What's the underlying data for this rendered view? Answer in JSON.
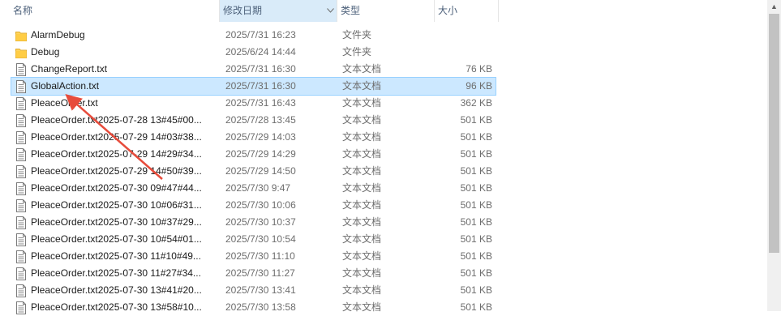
{
  "columns": {
    "name": "名称",
    "date": "修改日期",
    "type": "类型",
    "size": "大小"
  },
  "sort_indicator": "^",
  "dropdown_glyph": "v",
  "scroll_up_glyph": "▲",
  "files": [
    {
      "name": "AlarmDebug",
      "date": "2025/7/31 16:23",
      "type": "文件夹",
      "size": "",
      "icon": "folder-icon",
      "selected": false
    },
    {
      "name": "Debug",
      "date": "2025/6/24 14:44",
      "type": "文件夹",
      "size": "",
      "icon": "folder-icon",
      "selected": false
    },
    {
      "name": "ChangeReport.txt",
      "date": "2025/7/31 16:30",
      "type": "文本文档",
      "size": "76 KB",
      "icon": "text-file-icon",
      "selected": false
    },
    {
      "name": "GlobalAction.txt",
      "date": "2025/7/31 16:30",
      "type": "文本文档",
      "size": "96 KB",
      "icon": "text-file-icon",
      "selected": true
    },
    {
      "name": "PleaceOrder.txt",
      "date": "2025/7/31 16:43",
      "type": "文本文档",
      "size": "362 KB",
      "icon": "text-file-icon",
      "selected": false
    },
    {
      "name": "PleaceOrder.txt2025-07-28 13#45#00...",
      "date": "2025/7/28 13:45",
      "type": "文本文档",
      "size": "501 KB",
      "icon": "text-file-icon",
      "selected": false
    },
    {
      "name": "PleaceOrder.txt2025-07-29 14#03#38...",
      "date": "2025/7/29 14:03",
      "type": "文本文档",
      "size": "501 KB",
      "icon": "text-file-icon",
      "selected": false
    },
    {
      "name": "PleaceOrder.txt2025-07-29 14#29#34...",
      "date": "2025/7/29 14:29",
      "type": "文本文档",
      "size": "501 KB",
      "icon": "text-file-icon",
      "selected": false
    },
    {
      "name": "PleaceOrder.txt2025-07-29 14#50#39...",
      "date": "2025/7/29 14:50",
      "type": "文本文档",
      "size": "501 KB",
      "icon": "text-file-icon",
      "selected": false
    },
    {
      "name": "PleaceOrder.txt2025-07-30 09#47#44...",
      "date": "2025/7/30 9:47",
      "type": "文本文档",
      "size": "501 KB",
      "icon": "text-file-icon",
      "selected": false
    },
    {
      "name": "PleaceOrder.txt2025-07-30 10#06#31...",
      "date": "2025/7/30 10:06",
      "type": "文本文档",
      "size": "501 KB",
      "icon": "text-file-icon",
      "selected": false
    },
    {
      "name": "PleaceOrder.txt2025-07-30 10#37#29...",
      "date": "2025/7/30 10:37",
      "type": "文本文档",
      "size": "501 KB",
      "icon": "text-file-icon",
      "selected": false
    },
    {
      "name": "PleaceOrder.txt2025-07-30 10#54#01...",
      "date": "2025/7/30 10:54",
      "type": "文本文档",
      "size": "501 KB",
      "icon": "text-file-icon",
      "selected": false
    },
    {
      "name": "PleaceOrder.txt2025-07-30 11#10#49...",
      "date": "2025/7/30 11:10",
      "type": "文本文档",
      "size": "501 KB",
      "icon": "text-file-icon",
      "selected": false
    },
    {
      "name": "PleaceOrder.txt2025-07-30 11#27#34...",
      "date": "2025/7/30 11:27",
      "type": "文本文档",
      "size": "501 KB",
      "icon": "text-file-icon",
      "selected": false
    },
    {
      "name": "PleaceOrder.txt2025-07-30 13#41#20...",
      "date": "2025/7/30 13:41",
      "type": "文本文档",
      "size": "501 KB",
      "icon": "text-file-icon",
      "selected": false
    },
    {
      "name": "PleaceOrder.txt2025-07-30 13#58#10...",
      "date": "2025/7/30 13:58",
      "type": "文本文档",
      "size": "501 KB",
      "icon": "text-file-icon",
      "selected": false
    }
  ],
  "annotation": {
    "color": "#e74c3c",
    "points_to": "GlobalAction.txt"
  },
  "colors": {
    "selection": "#cce8ff",
    "selection_border": "#99d1ff",
    "sorted_header": "#d9ebf9",
    "folder": "#ffd45e"
  }
}
